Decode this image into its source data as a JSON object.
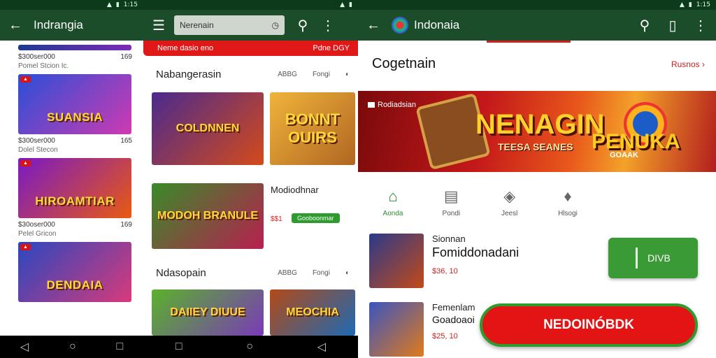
{
  "status": {
    "time": "1:15"
  },
  "panel1": {
    "title": "Indrangia",
    "cards": [
      {
        "title": "",
        "line1": "$300ser000",
        "line1_right": "169",
        "line2": "Pomel Stcion Ic.",
        "colors": [
          "#1b3b8f",
          "#7e2bb8"
        ]
      },
      {
        "title": "SUANSIA",
        "line1": "$300ser000",
        "line1_right": "165",
        "line2": "Dolel Stecon",
        "colors": [
          "#2a4fd8",
          "#cf3ab1"
        ]
      },
      {
        "title": "HIROAMTIAR",
        "line1": "$30oser000",
        "line1_right": "169",
        "line2": "Pelel Gricon",
        "colors": [
          "#7a1ac5",
          "#e85a11"
        ]
      },
      {
        "title": "DENDAIA",
        "line1": "",
        "line1_right": "",
        "line2": "",
        "colors": [
          "#2a47c0",
          "#d83a7a"
        ]
      }
    ]
  },
  "panel2": {
    "search_text": "Nerenain",
    "strip_left": "Neme dasio eno",
    "strip_right": "Pdne DGY",
    "section1": {
      "title": "Nabangerasin",
      "right1": "ABBG",
      "right2": "Fongi"
    },
    "section2": {
      "title": "Ndasopain",
      "right1": "ABBG",
      "right2": "Fongi"
    },
    "tiles": [
      {
        "text": "COLDNNEN",
        "colors": [
          "#4a2a8f",
          "#d44a1a"
        ]
      },
      {
        "text": "BONNT OUIRS",
        "colors": [
          "#f0b43a",
          "#b06622"
        ]
      },
      {
        "text": "MODOH BRANULE",
        "colors": [
          "#3a8a2a",
          "#b81f4f"
        ]
      },
      {
        "text": "DAIIEY DIUUE",
        "colors": [
          "#5ab22a",
          "#7a3ab8"
        ]
      },
      {
        "text": "MEOCHIA",
        "colors": [
          "#b24a18",
          "#1e6ab4"
        ]
      }
    ],
    "side_title": "Modiodhnar",
    "side_price": "$$1",
    "side_pill": "Gooboonmar"
  },
  "panel3": {
    "title": "Indonaia",
    "section_title": "Cogetnain",
    "section_link": "Rusnos",
    "banner": {
      "label": "Rodiadsian",
      "big": "NENAGIN",
      "sub": "TEESA SEANES",
      "right_big": "PENUKA",
      "right_sub": "GOAAK"
    },
    "categories": [
      {
        "label": "Aonda",
        "icon": "⌂"
      },
      {
        "label": "Pondi",
        "icon": "▤"
      },
      {
        "label": "Jeesl",
        "icon": "◈"
      },
      {
        "label": "Hlsogi",
        "icon": "♦"
      }
    ],
    "apps": [
      {
        "t1": "Sionnan",
        "t2": "Fomiddonadani",
        "price": "$36, 10",
        "colors": [
          "#2a3a8a",
          "#c34a18"
        ]
      },
      {
        "t1": "Femenlam",
        "t2": "Goadoaoi",
        "price": "$25, 10",
        "colors": [
          "#3a55c0",
          "#e07a1a"
        ]
      }
    ],
    "install_label": "DIVB",
    "cta_label": "NEDOINÓBDK"
  },
  "nav": {
    "back": "◁",
    "home": "○",
    "recent": "□"
  }
}
